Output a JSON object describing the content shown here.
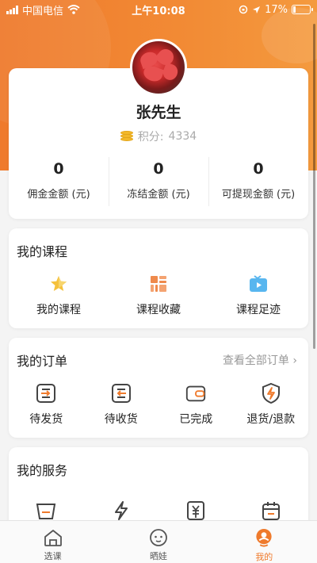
{
  "status_bar": {
    "carrier": "中国电信",
    "time": "上午10:08",
    "battery": "17%",
    "battery_level": 0.17
  },
  "profile": {
    "name": "张先生",
    "points_label": "积分:",
    "points_value": "4334",
    "stats": [
      {
        "value": "0",
        "label": "佣金金额 (元)"
      },
      {
        "value": "0",
        "label": "冻结金额 (元)"
      },
      {
        "value": "0",
        "label": "可提现金额 (元)"
      }
    ]
  },
  "courses": {
    "title": "我的课程",
    "items": [
      {
        "label": "我的课程",
        "icon": "star-icon"
      },
      {
        "label": "课程收藏",
        "icon": "grid-icon"
      },
      {
        "label": "课程足迹",
        "icon": "tv-icon"
      }
    ]
  },
  "orders": {
    "title": "我的订单",
    "view_all": "查看全部订单",
    "items": [
      {
        "label": "待发货",
        "icon": "ship-icon"
      },
      {
        "label": "待收货",
        "icon": "receive-icon"
      },
      {
        "label": "已完成",
        "icon": "wallet-icon"
      },
      {
        "label": "退货/退款",
        "icon": "refund-icon"
      }
    ]
  },
  "services": {
    "title": "我的服务"
  },
  "tabbar": [
    {
      "label": "选课",
      "icon": "house-icon",
      "active": false
    },
    {
      "label": "晒娃",
      "icon": "face-icon",
      "active": false
    },
    {
      "label": "我的",
      "icon": "profile-icon",
      "active": true
    }
  ],
  "colors": {
    "accent": "#ef7a2c",
    "icon_gray": "#444444",
    "star": "#f5c13c",
    "tv": "#58b6ef"
  }
}
